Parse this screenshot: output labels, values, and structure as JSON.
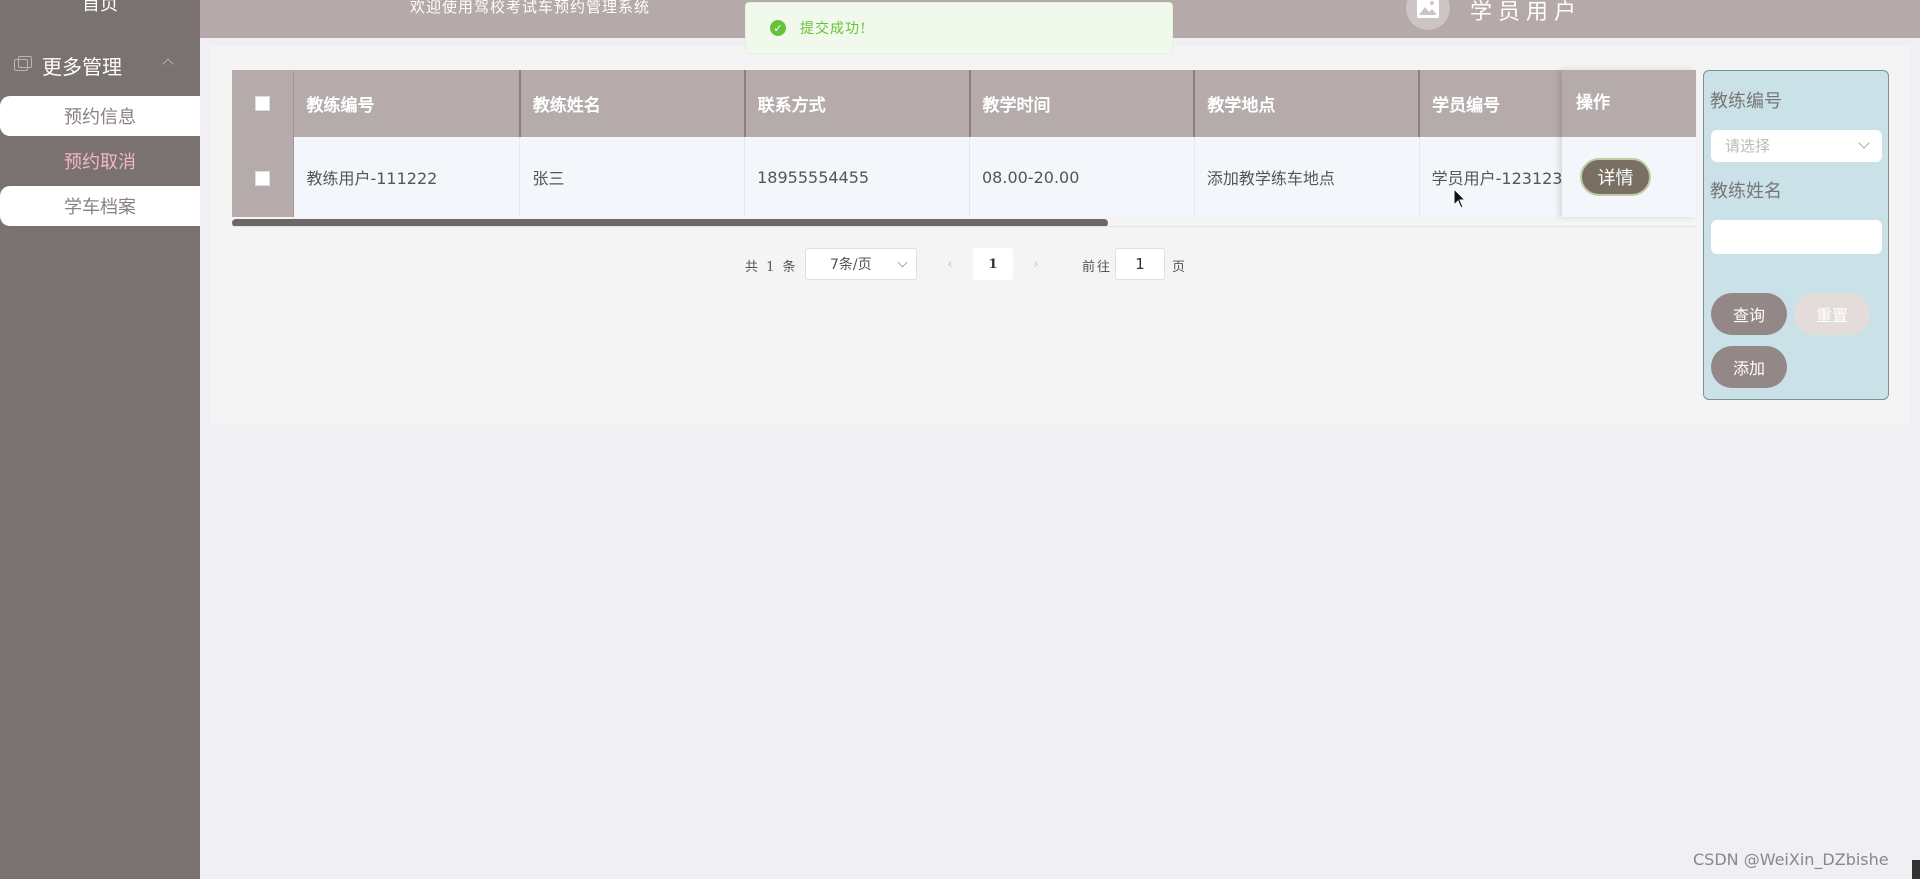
{
  "sidebar": {
    "home": "首页",
    "group_label": "更多管理",
    "items": [
      {
        "label": "预约信息"
      },
      {
        "label": "预约取消"
      },
      {
        "label": "学车档案"
      }
    ]
  },
  "header": {
    "welcome": "欢迎使用驾校考试车预约管理系统",
    "user": "学员用户"
  },
  "toast": {
    "message": "提交成功!"
  },
  "table": {
    "columns": [
      "教练编号",
      "教练姓名",
      "联系方式",
      "教学时间",
      "教学地点",
      "学员编号",
      "操作"
    ],
    "rows": [
      {
        "coach_id": "教练用户-111222",
        "coach_name": "张三",
        "phone": "18955554455",
        "time": "08.00-20.00",
        "place": "添加教学练车地点",
        "student_id": "学员用户-123123",
        "action": "详情"
      }
    ]
  },
  "pagination": {
    "total": "共 1 条",
    "page_size": "7条/页",
    "current_page": "1",
    "goto_label": "前往",
    "goto_value": "1",
    "unit": "页"
  },
  "search": {
    "coach_id_label": "教练编号",
    "coach_id_placeholder": "请选择",
    "coach_name_label": "教练姓名",
    "query_button": "查询",
    "reset_button": "重置",
    "add_button": "添加"
  },
  "watermark": "CSDN @WeiXin_DZbishe",
  "colors": {
    "sidebar_bg": "#7a7171",
    "header_bg": "#b5abab",
    "active_item": "#f3b9bf",
    "search_panel_bg": "#cbe1e8",
    "success": "#67c23a"
  }
}
